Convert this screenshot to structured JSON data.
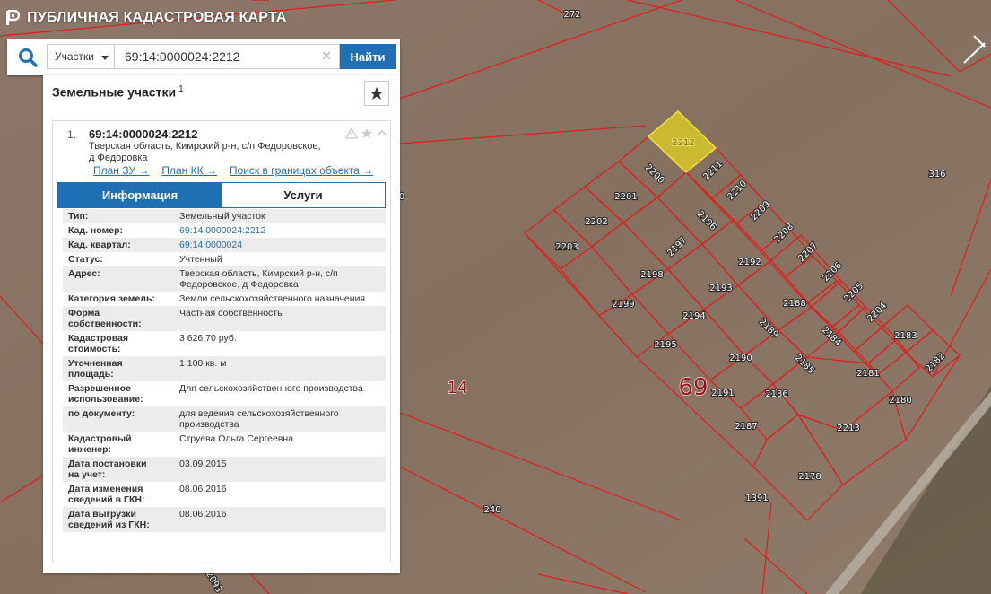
{
  "header": {
    "title": "ПУБЛИЧНАЯ КАДАСТРОВАЯ КАРТА"
  },
  "search": {
    "type_label": "Участки",
    "value": "69:14:0000024:2212",
    "button_label": "Найти"
  },
  "panel": {
    "title": "Земельные участки",
    "count": "1",
    "result": {
      "index": "1.",
      "cadnum": "69:14:0000024:2212",
      "address_line1": "Тверская область, Кимрский р-н, с/п Федоровское,",
      "address_line2": "д Федоровка",
      "links": {
        "plan_zu": "План ЗУ →",
        "plan_kk": "План КК →",
        "search_bounds": "Поиск в границах объекта →"
      },
      "tabs": {
        "info": "Информация",
        "services": "Услуги"
      },
      "rows": [
        {
          "k1": "Тип:",
          "k2": "",
          "v1": "Земельный участок",
          "v2": ""
        },
        {
          "k1": "Кад. номер:",
          "k2": "",
          "v1": "69:14:0000024:2212",
          "v2": ""
        },
        {
          "k1": "Кад. квартал:",
          "k2": "",
          "v1": "69:14:0000024",
          "v2": ""
        },
        {
          "k1": "Статус:",
          "k2": "",
          "v1": "Учтенный",
          "v2": ""
        },
        {
          "k1": "Адрес:",
          "k2": "",
          "v1": "Тверская область, Кимрский р-н, с/п",
          "v2": "Федоровское, д Федоровка"
        },
        {
          "k1": "Категория земель:",
          "k2": "",
          "v1": "Земли сельскохозяйственного назначения",
          "v2": ""
        },
        {
          "k1": "Форма",
          "k2": "собственности:",
          "v1": "Частная собственность",
          "v2": ""
        },
        {
          "k1": "Кадастровая",
          "k2": "стоимость:",
          "v1": "3 626,70 руб.",
          "v2": ""
        },
        {
          "k1": "Уточненная",
          "k2": "площадь:",
          "v1": "1 100 кв. м",
          "v2": ""
        },
        {
          "k1": "Разрешенное",
          "k2": "использование:",
          "v1": "Для сельскохозяйственного производства",
          "v2": ""
        },
        {
          "k1": "по документу:",
          "k2": "",
          "v1": "для ведения сельскохозяйственного",
          "v2": "производства"
        },
        {
          "k1": "Кадастровый",
          "k2": "инженер:",
          "v1": "Струева Ольга Сергеевна",
          "v2": ""
        },
        {
          "k1": "Дата постановки",
          "k2": "на учет:",
          "v1": "03.09.2015",
          "v2": ""
        },
        {
          "k1": "Дата изменения",
          "k2": "сведений в ГКН:",
          "v1": "08.06.2016",
          "v2": ""
        },
        {
          "k1": "Дата выгрузки",
          "k2": "сведений из ГКН:",
          "v1": "08.06.2016",
          "v2": ""
        }
      ]
    }
  },
  "map": {
    "labels": {
      "l272": "272",
      "l316": "316",
      "l14": "14",
      "l69": "69",
      "l240": "240",
      "l1391": "1391",
      "l2093": "2093",
      "l0": "0",
      "p2212": "2212",
      "p2211": "2211",
      "p2210": "2210",
      "p2209": "2209",
      "p2208": "2208",
      "p2207": "2207",
      "p2206": "2206",
      "p2205": "2205",
      "p2204": "2204",
      "p2183": "2183",
      "p2182": "2182",
      "p2200": "2200",
      "p2201": "2201",
      "p2202": "2202",
      "p2203": "2203",
      "p2196": "2196",
      "p2197": "2197",
      "p2198": "2198",
      "p2199": "2199",
      "p2192": "2192",
      "p2193": "2193",
      "p2194": "2194",
      "p2195": "2195",
      "p2188": "2188",
      "p2189": "2189",
      "p2184": "2184",
      "p2185": "2185",
      "p2190": "2190",
      "p2191": "2191",
      "p2186": "2186",
      "p2187": "2187",
      "p2181": "2181",
      "p2180": "2180",
      "p2213": "2213",
      "p2178": "2178"
    },
    "colors": {
      "boundary": "#e31b1b",
      "selected_fill": "#d7c52a",
      "ground": "#8a7566"
    }
  }
}
